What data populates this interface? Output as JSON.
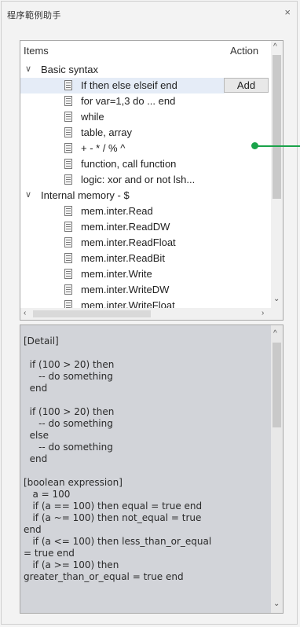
{
  "window": {
    "title": "程序範例助手",
    "close_glyph": "×"
  },
  "tree": {
    "header": {
      "items_label": "Items",
      "action_label": "Action"
    },
    "groups": [
      {
        "label": "Basic syntax",
        "expanded": true,
        "items": [
          {
            "label": "If then else elseif end",
            "selected": true,
            "action": "Add"
          },
          {
            "label": "for var=1,3 do ... end"
          },
          {
            "label": "while"
          },
          {
            "label": "table, array"
          },
          {
            "label": "+ - * / % ^"
          },
          {
            "label": "function, call function"
          },
          {
            "label": "logic: xor and or not lsh..."
          }
        ]
      },
      {
        "label": "Internal memory - $",
        "expanded": true,
        "items": [
          {
            "label": "mem.inter.Read"
          },
          {
            "label": "mem.inter.ReadDW"
          },
          {
            "label": "mem.inter.ReadFloat"
          },
          {
            "label": "mem.inter.ReadBit"
          },
          {
            "label": "mem.inter.Write"
          },
          {
            "label": "mem.inter.WriteDW"
          },
          {
            "label": "mem.inter.WriteFloat"
          }
        ]
      }
    ],
    "icons": {
      "expander": "chevron-down-icon",
      "item": "document-icon"
    }
  },
  "detail": {
    "text": "[Detail]\n\n  if (100 > 20) then\n     -- do something\n  end\n\n  if (100 > 20) then\n     -- do something\n  else\n     -- do something\n  end\n\n[boolean expression]\n   a = 100\n   if (a == 100) then equal = true end\n   if (a ~= 100) then not_equal = true\nend\n   if (a <= 100) then less_than_or_equal\n= true end\n   if (a >= 100) then\ngreater_than_or_equal = true end"
  },
  "colors": {
    "callout": "#1aa34a",
    "selection": "#e5ecf7",
    "detail_background": "#d2d4d9"
  }
}
